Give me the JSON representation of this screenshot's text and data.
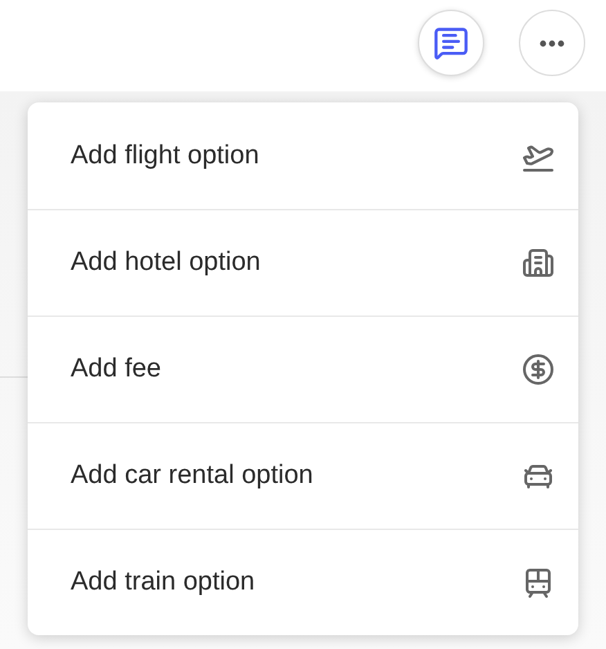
{
  "toolbar": {
    "buttons": [
      {
        "kind": "comment",
        "selected": true
      },
      {
        "kind": "more",
        "selected": false
      }
    ]
  },
  "menu": {
    "items": [
      {
        "label": "Add flight option",
        "kind": "flight"
      },
      {
        "label": "Add hotel option",
        "kind": "hotel"
      },
      {
        "label": "Add fee",
        "kind": "fee"
      },
      {
        "label": "Add car rental option",
        "kind": "car"
      },
      {
        "label": "Add train option",
        "kind": "train"
      }
    ]
  }
}
